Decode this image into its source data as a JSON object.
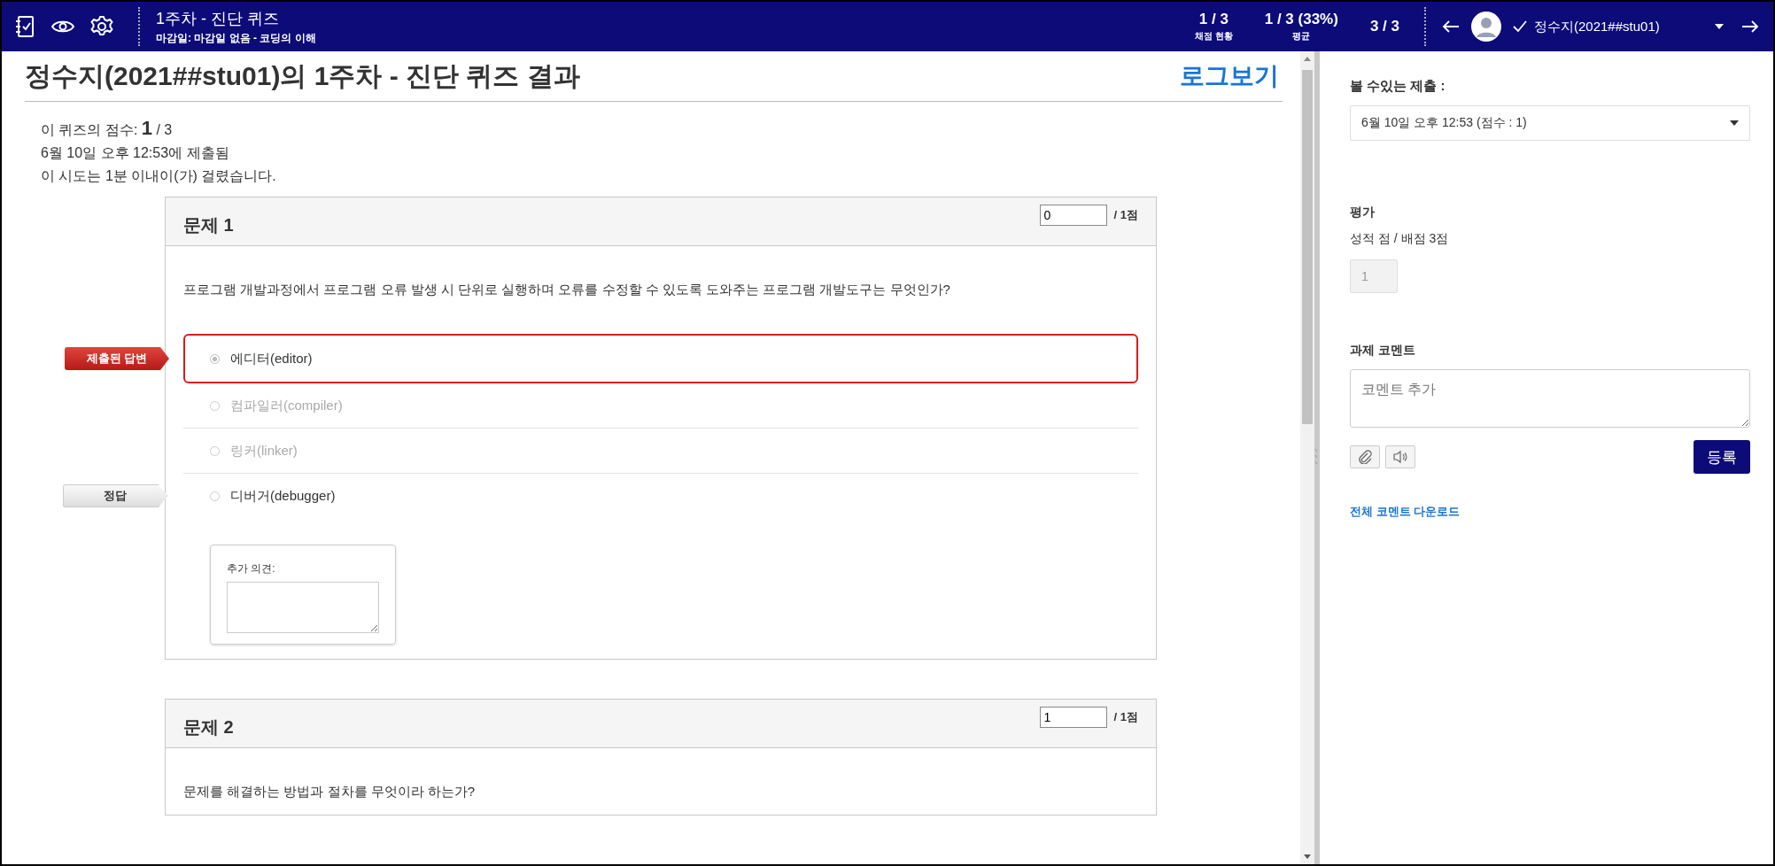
{
  "top_bar": {
    "title": "1주차 - 진단 퀴즈",
    "subtitle": "마감일: 마감일 없음 - 코딩의 이해",
    "stats": [
      {
        "value": "1 / 3",
        "label": "채점 현황"
      },
      {
        "value": "1 / 3 (33%)",
        "label": "평균"
      },
      {
        "value": "3 / 3"
      }
    ],
    "student": {
      "name": "정수지(2021##stu01)",
      "checked": true
    }
  },
  "main": {
    "heading": "정수지(2021##stu01)의 1주차 - 진단 퀴즈 결과",
    "log_link": "로그보기",
    "summary": [
      "이 퀴즈의 점수: **1** / 3",
      "6월 10일 오후 12:53에 제출됨",
      "이 시도는 1분 이내이(가) 걸렸습니다."
    ],
    "questions": [
      {
        "title": "문제 1",
        "points_value": "0",
        "points_label": "/ 1점",
        "text": "프로그램 개발과정에서 프로그램 오류 발생 시 단위로 실행하며 오류를 수정할 수 있도록 도와주는 프로그램 개발도구는 무엇인가?",
        "answers": [
          {
            "label": "에디터(editor)",
            "selected": true,
            "muted": false,
            "marker": {
              "kind": "submitted",
              "label": "제출된 답변"
            }
          },
          {
            "label": "컴파일러(compiler)",
            "selected": false,
            "muted": true
          },
          {
            "label": "링커(linker)",
            "selected": false,
            "muted": true
          },
          {
            "label": "디버거(debugger)",
            "selected": false,
            "muted": false,
            "marker": {
              "kind": "correct",
              "label": "정답"
            }
          }
        ],
        "comment_label": "추가 의견:"
      },
      {
        "title": "문제 2",
        "points_value": "1",
        "points_label": "/ 1점",
        "text": "문제를 해결하는 방법과 절차를 무엇이라 하는가?"
      }
    ]
  },
  "side_panel": {
    "submissions_label": "볼 수있는 제출 :",
    "submission_value": "6월 10일 오후 12:53 (점수 : 1)",
    "grading_heading": "평가",
    "grade_label": "성적 점 / 배점 3점",
    "grade_value": "1",
    "comments_heading": "과제 코멘트",
    "comment_placeholder": "코멘트 추가",
    "submit_button": "등록",
    "download_link": "전체 코멘트 다운로드"
  }
}
